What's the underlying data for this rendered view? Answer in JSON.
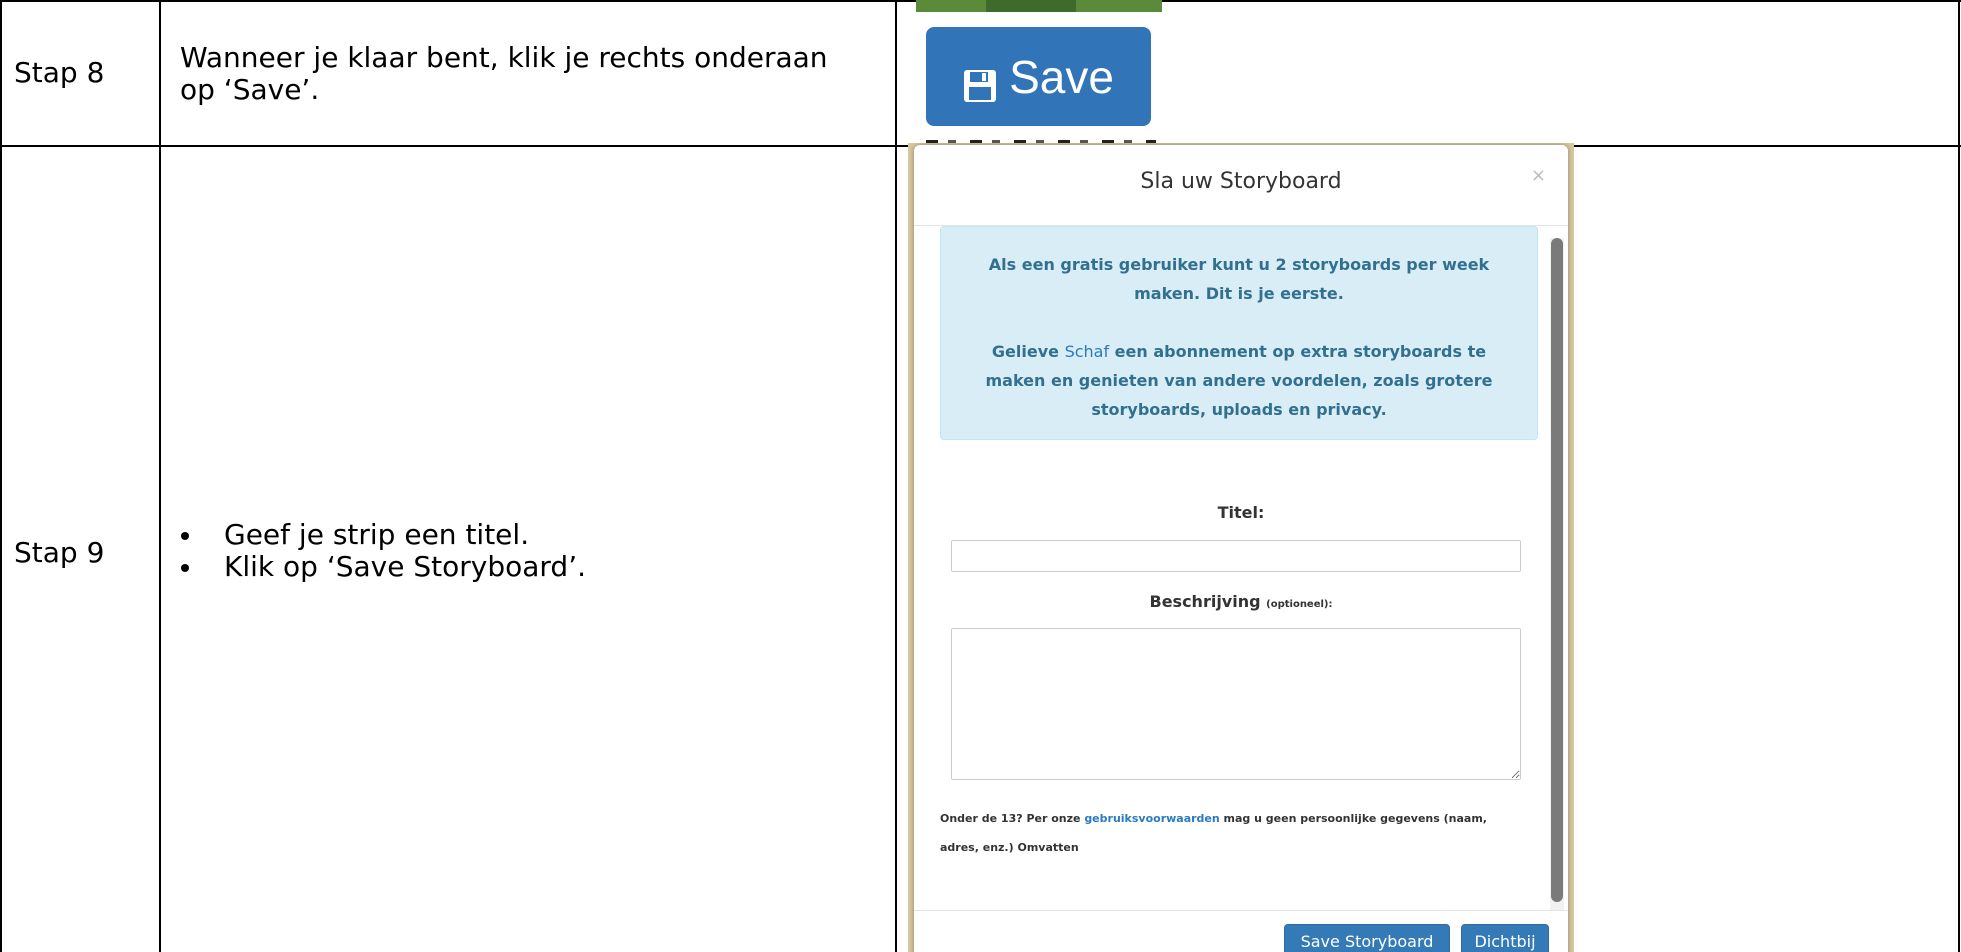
{
  "rows": [
    {
      "step": "Stap 8",
      "instruction_lines": [
        "Wanneer je klaar bent, klik je rechts onderaan",
        "op ‘Save’."
      ]
    },
    {
      "step": "Stap 9",
      "bullets": [
        "Geef je strip een titel.",
        "Klik op ‘Save Storyboard’."
      ]
    }
  ],
  "save_button": {
    "label": "Save",
    "icon": "floppy-disk-icon",
    "color": "#3174b8"
  },
  "modal": {
    "title": "Sla uw Storyboard",
    "close_glyph": "×",
    "info": {
      "line1": "Als een gratis gebruiker kunt u 2 storyboards per week maken. Dit is je eerste.",
      "line2_prefix": "Gelieve ",
      "line2_link": "Schaf",
      "line2_suffix": " een abonnement op extra storyboards te maken en genieten van andere voordelen, zoals grotere storyboards, uploads en privacy."
    },
    "title_label": "Titel:",
    "title_value": "",
    "description_label": "Beschrijving",
    "description_optional": "(optioneel):",
    "description_value": "",
    "terms": {
      "prefix": "Onder de 13? Per onze ",
      "link": "gebruiksvoorwaarden",
      "suffix": " mag u geen persoonlijke gegevens (naam, adres, enz.) Omvatten"
    },
    "buttons": {
      "save": "Save Storyboard",
      "close": "Dichtbij"
    },
    "colors": {
      "info_bg": "#d9edf7",
      "info_text": "#31708f",
      "link": "#2a7bc0",
      "primary": "#337ab7"
    }
  }
}
